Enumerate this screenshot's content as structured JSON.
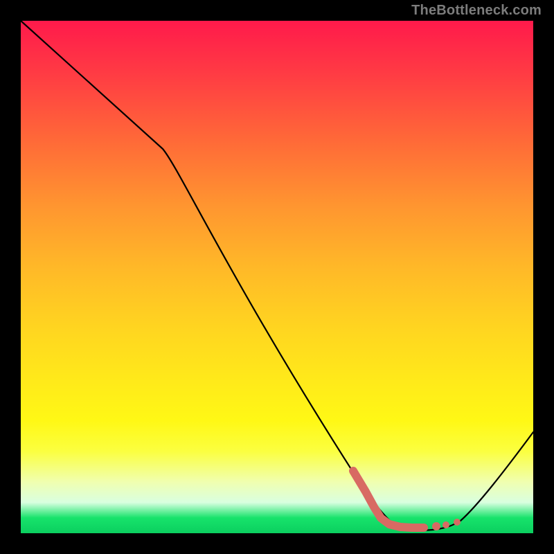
{
  "watermark_text": "TheBottleneck.com",
  "chart_data": {
    "type": "line",
    "title": "",
    "xlabel": "",
    "ylabel": "",
    "xlim": [
      0,
      100
    ],
    "ylim": [
      0,
      100
    ],
    "grid": false,
    "legend": false,
    "series": [
      {
        "name": "bottleneck-curve",
        "x": [
          0,
          28,
          65,
          73,
          80,
          84,
          100
        ],
        "values": [
          100,
          75,
          12,
          1.5,
          0.5,
          1,
          20
        ]
      }
    ],
    "annotations": [
      {
        "name": "optimal-zone-marker",
        "type": "highlight",
        "x_start": 65,
        "x_end": 84,
        "y": 1
      }
    ],
    "background_gradient": {
      "top_color": "#ff1a4b",
      "bottom_color": "#0bcf5f",
      "description": "red-to-yellow-to-green vertical gradient (red = high bottleneck, green = low)"
    }
  }
}
